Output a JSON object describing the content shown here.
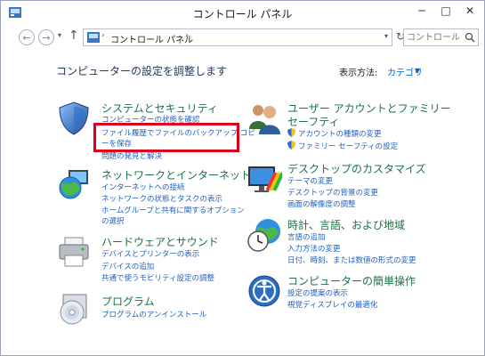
{
  "window": {
    "title": "コントロール パネル",
    "min": "─",
    "max": "□",
    "close": "✕"
  },
  "nav": {
    "back": "←",
    "forward": "→",
    "up": "↑",
    "dropdown": "▾",
    "breadcrumb": "コントロール パネル",
    "sep": "›",
    "refresh": "↻",
    "search_placeholder": "コントロール..."
  },
  "page": {
    "heading": "コンピューターの設定を調整します",
    "view_by_label": "表示方法:",
    "view_by_value": "カテゴリ",
    "view_by_arrow": "▼"
  },
  "categories": {
    "system": {
      "title": "システムとセキュリティ",
      "links": [
        "コンピューターの状態を確認",
        "ファイル履歴でファイルのバックアップ コピ",
        "ーを保存",
        "問題の発見と解決"
      ]
    },
    "network": {
      "title": "ネットワークとインターネット",
      "links": [
        "インターネットへの接続",
        "ネットワークの状態とタスクの表示",
        "ホームグループと共有に関するオプション",
        "の選択"
      ]
    },
    "hardware": {
      "title": "ハードウェアとサウンド",
      "links": [
        "デバイスとプリンターの表示",
        "デバイスの追加",
        "共通で使うモビリティ設定の調整"
      ]
    },
    "programs": {
      "title": "プログラム",
      "links": [
        "プログラムのアンインストール"
      ]
    },
    "users": {
      "title1": "ユーザー アカウントとファミリー",
      "title2": "セーフティ",
      "links": [
        "アカウントの種類の変更",
        "ファミリー セーフティの設定"
      ]
    },
    "appearance": {
      "title": "デスクトップのカスタマイズ",
      "links": [
        "テーマの変更",
        "デスクトップの背景の変更",
        "画面の解像度の調整"
      ]
    },
    "clock": {
      "title": "時計、言語、および地域",
      "links": [
        "言語の追加",
        "入力方法の変更",
        "日付、時刻、または数値の形式の変更"
      ]
    },
    "ease": {
      "title": "コンピューターの簡単操作",
      "links": [
        "設定の提案の表示",
        "視覚ディスプレイの最適化"
      ]
    }
  }
}
